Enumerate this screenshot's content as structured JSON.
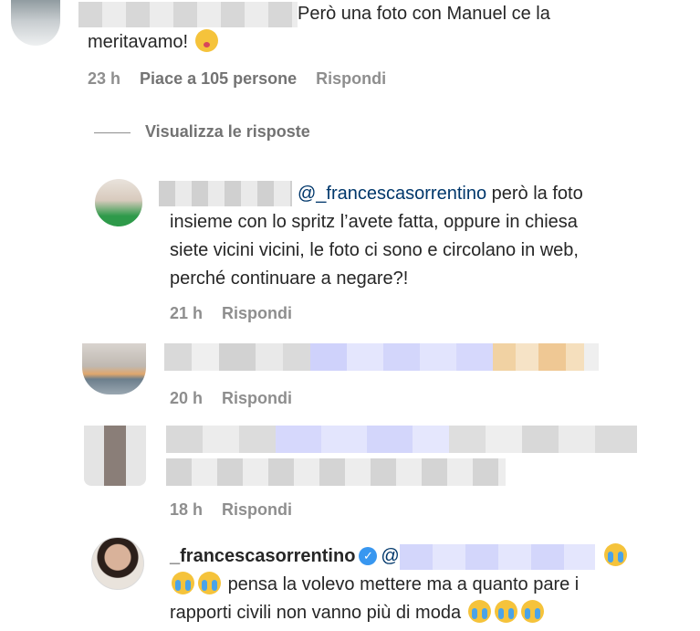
{
  "comments": [
    {
      "text_line1": "Però una foto con Manuel ce la",
      "text_line2": "meritavamo!",
      "time": "23 h",
      "likes": "Piace a 105 persone",
      "reply": "Rispondi",
      "view_replies": "Visualizza le risposte"
    }
  ],
  "replies": [
    {
      "mention": "@_francescasorrentino",
      "text_line1": " però la foto",
      "text_line2": "insieme con lo spritz l’avete fatta, oppure in chiesa",
      "text_line3": "siete vicini vicini, le foto ci sono e circolano in web,",
      "text_line4": "perché continuare a negare?!",
      "time": "21 h",
      "reply": "Rispondi"
    },
    {
      "time": "20 h",
      "reply": "Rispondi"
    },
    {
      "time": "18 h",
      "reply": "Rispondi"
    },
    {
      "username": "_francescasorrentino",
      "mention": "@",
      "text_line2": "pensa la volevo mettere ma a quanto pare i",
      "text_line3": "rapporti civili non vanno più di moda"
    }
  ],
  "icons": {
    "verified": "verified-badge-icon",
    "kiss": "kissing-face-emoji",
    "cry": "crying-face-emoji"
  },
  "colors": {
    "meta_gray": "#8e8e8e",
    "mention_blue": "#00376b",
    "verified_blue": "#3897f0"
  }
}
